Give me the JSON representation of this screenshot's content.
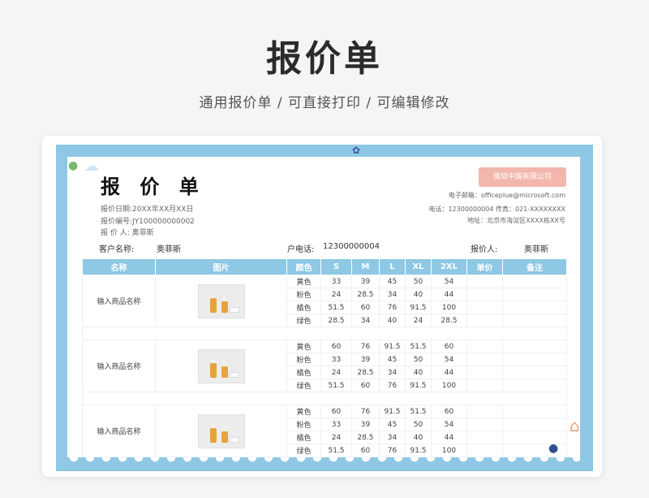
{
  "hero": {
    "title": "报价单",
    "subtitle": "通用报价单 / 可直接打印 / 可编辑修改"
  },
  "doc": {
    "title": "报 价 单",
    "date_line": "报价日期:20XX年XX月XX日",
    "number_line": "报价编号:JY100000000002",
    "person_line": "报 价 人:  奥菲斯",
    "company_button": "微软中国有限公司",
    "email_line": "电子邮箱：officeplue@microsoft.com",
    "phone_line": "电话：12300000004   传真：021-XXXXXXXX",
    "address_line": "地址：北京市海淀区XXXX栋XX号"
  },
  "client": {
    "name_label": "客户名称:",
    "name_value": "奥菲斯",
    "phone_label": "户电话:",
    "phone_value": "12300000004",
    "quoter_label": "报价人:",
    "quoter_value": "奥菲斯"
  },
  "table": {
    "headers": [
      "名称",
      "图片",
      "颜色",
      "S",
      "M",
      "L",
      "XL",
      "2XL",
      "单价",
      "备注"
    ],
    "groups": [
      {
        "name": "输入商品名称",
        "rows": [
          [
            "黄色",
            "33",
            "39",
            "45",
            "50",
            "54"
          ],
          [
            "粉色",
            "24",
            "28.5",
            "34",
            "40",
            "44"
          ],
          [
            "橘色",
            "51.5",
            "60",
            "76",
            "91.5",
            "100"
          ],
          [
            "绿色",
            "28.5",
            "34",
            "40",
            "24",
            "28.5"
          ]
        ]
      },
      {
        "name": "输入商品名称",
        "rows": [
          [
            "黄色",
            "60",
            "76",
            "91.5",
            "51.5",
            "60"
          ],
          [
            "粉色",
            "33",
            "39",
            "45",
            "50",
            "54"
          ],
          [
            "橘色",
            "24",
            "28.5",
            "34",
            "40",
            "44"
          ],
          [
            "绿色",
            "51.5",
            "60",
            "76",
            "91.5",
            "100"
          ]
        ]
      },
      {
        "name": "输入商品名称",
        "rows": [
          [
            "黄色",
            "60",
            "76",
            "91.5",
            "51.5",
            "60"
          ],
          [
            "粉色",
            "33",
            "39",
            "45",
            "50",
            "54"
          ],
          [
            "橘色",
            "24",
            "28.5",
            "34",
            "40",
            "44"
          ],
          [
            "绿色",
            "51.5",
            "60",
            "76",
            "91.5",
            "100"
          ]
        ]
      }
    ]
  },
  "colors": {
    "frame": "#8ec8e4",
    "accent": "#f3b6ad"
  }
}
